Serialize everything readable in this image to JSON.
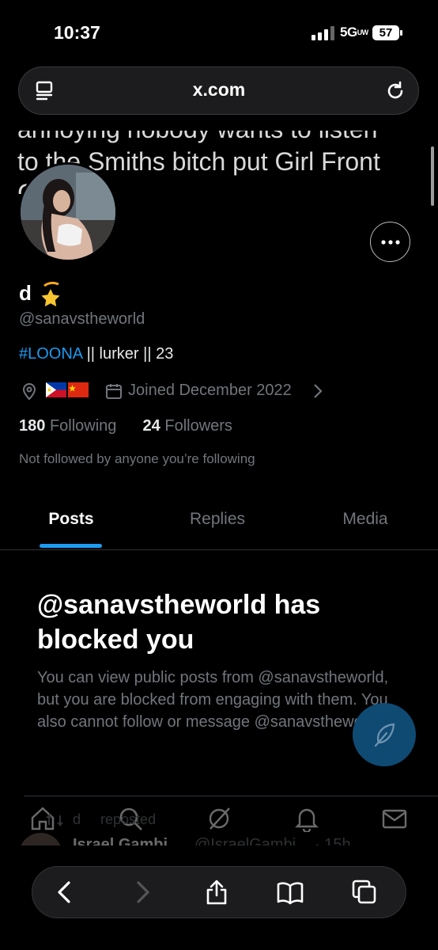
{
  "status": {
    "time": "10:37",
    "network": "5G",
    "battery": "57"
  },
  "browser": {
    "url": "x.com"
  },
  "banner": {
    "line1": "annoying nobody wants to listen",
    "line2": "to the Smiths bitch put Girl Front",
    "line3": "C"
  },
  "profile": {
    "display_name": "d",
    "handle": "@sanavstheworld",
    "bio_tag": "#LOONA",
    "bio_rest": " || lurker || 23",
    "joined": "Joined December 2022",
    "following_count": "180",
    "following_label": "Following",
    "followers_count": "24",
    "followers_label": "Followers",
    "not_followed": "Not followed by anyone you’re following"
  },
  "tabs": [
    {
      "label": "Posts",
      "active": true
    },
    {
      "label": "Replies",
      "active": false
    },
    {
      "label": "Media",
      "active": false
    }
  ],
  "blocked": {
    "title": "@sanavstheworld has blocked you",
    "body": "You can view public posts from @sanavstheworld, but you are blocked from engaging with them. You also cannot follow or message @sanavstheworld."
  },
  "feed_preview": {
    "repost_label": "reposted",
    "repost_user": "d",
    "author": "Israel Gambi",
    "author_handle": "@IsraelGambi",
    "time": "· 15h"
  },
  "colors": {
    "accent": "#1d9bf0",
    "fab": "#0f4a73",
    "muted": "#71767b"
  }
}
